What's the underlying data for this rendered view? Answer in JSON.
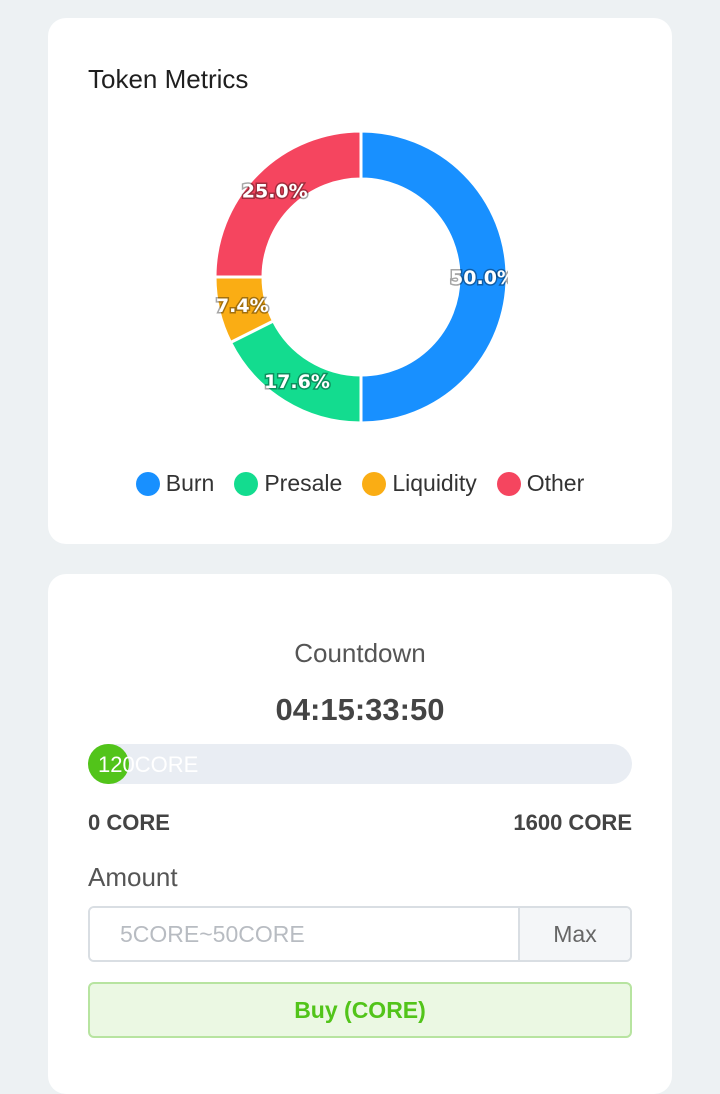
{
  "metrics": {
    "title": "Token Metrics"
  },
  "chart_data": {
    "type": "pie",
    "style": "donut",
    "title": "Token Metrics",
    "categories": [
      "Burn",
      "Presale",
      "Liquidity",
      "Other"
    ],
    "values": [
      50.0,
      17.6,
      7.4,
      25.0
    ],
    "value_labels": [
      "50.0%",
      "17.6%",
      "7.4%",
      "25.0%"
    ],
    "colors": [
      "#1890ff",
      "#13dc8f",
      "#faad14",
      "#f5455f"
    ],
    "legend_position": "bottom"
  },
  "presale": {
    "countdown_label": "Countdown",
    "countdown_value": "04:15:33:50",
    "progress_text": "120CORE",
    "progress_fraction": 0.075,
    "progress_color": "#52c41a",
    "range_min": "0 CORE",
    "range_max": "1600 CORE",
    "amount_label": "Amount",
    "amount_placeholder": "5CORE~50CORE",
    "max_label": "Max",
    "buy_label": "Buy (CORE)"
  }
}
